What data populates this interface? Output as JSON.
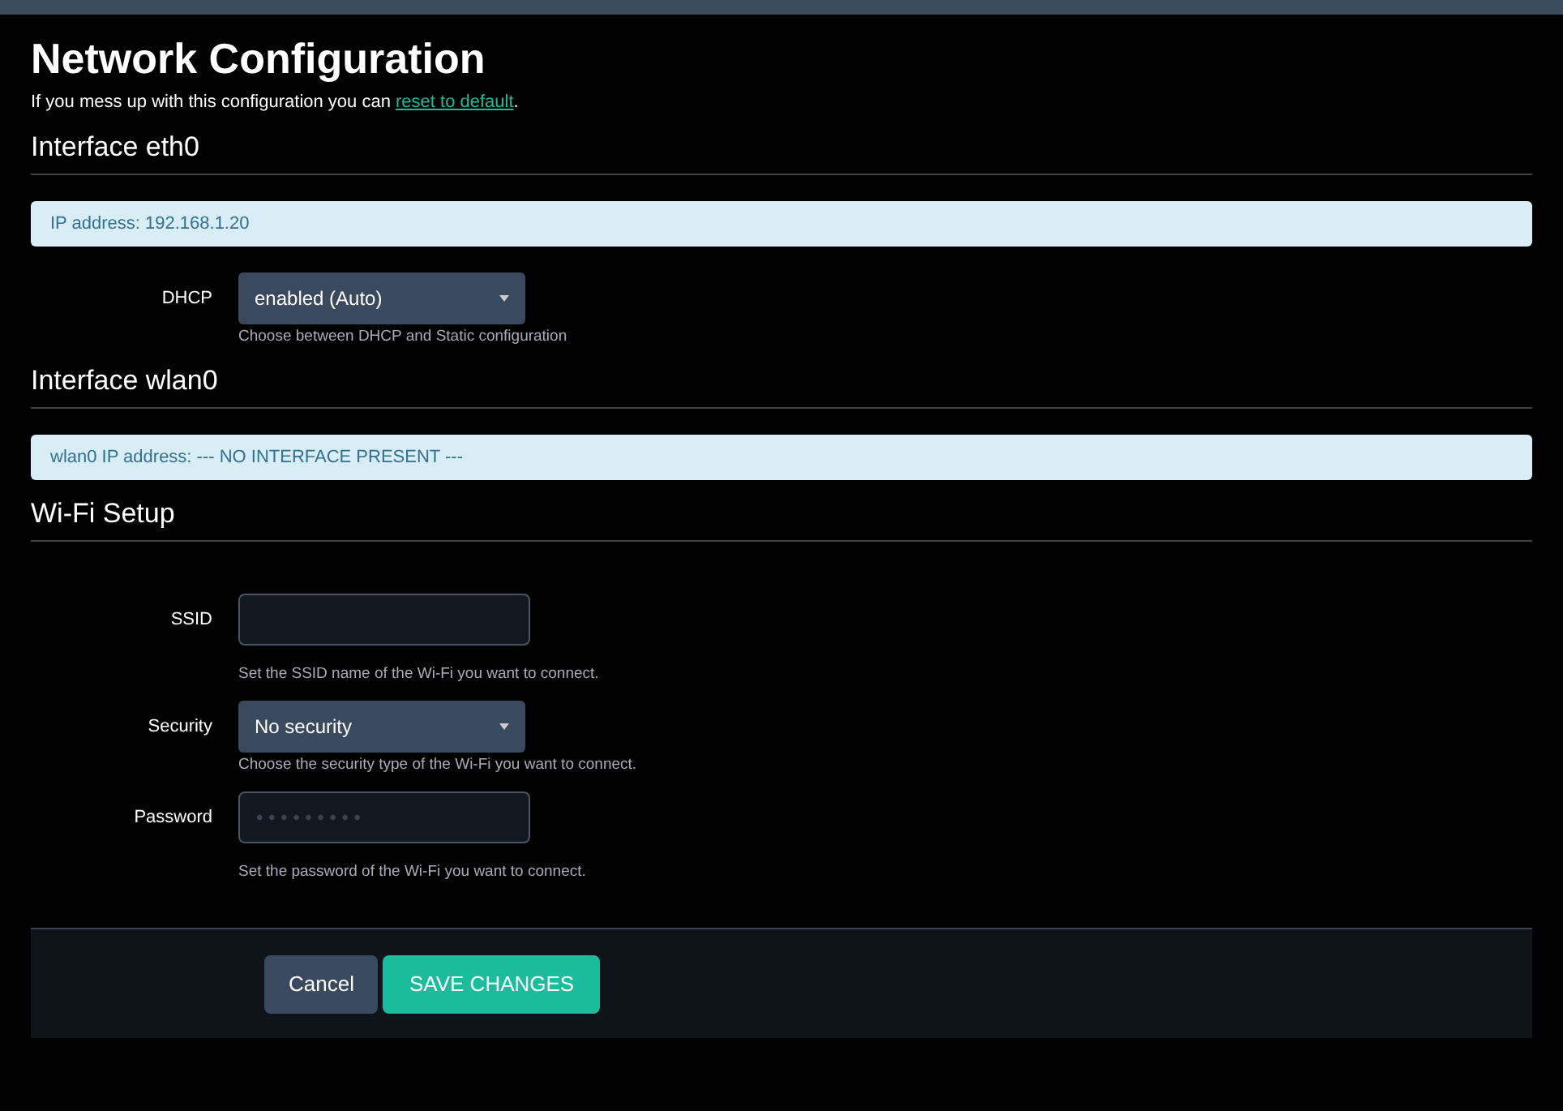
{
  "title": "Network Configuration",
  "intro": {
    "before": "If you mess up with this configuration you can ",
    "link": "reset to default",
    "after": "."
  },
  "sections": [
    {
      "heading": "Interface eth0",
      "alert": "IP address: 192.168.1.20",
      "fields": [
        {
          "kind": "select",
          "label": "DHCP",
          "value": "enabled (Auto)",
          "help": "Choose between DHCP and Static configuration"
        }
      ]
    },
    {
      "heading": "Interface wlan0",
      "alert": "wlan0 IP address: --- NO INTERFACE PRESENT ---"
    },
    {
      "heading": "Wi-Fi Setup",
      "fields": [
        {
          "kind": "text",
          "label": "SSID",
          "help": "Set the SSID name of the Wi-Fi you want to connect."
        },
        {
          "kind": "select",
          "label": "Security",
          "value": "No security",
          "help": "Choose the security type of the Wi-Fi you want to connect."
        },
        {
          "kind": "password",
          "label": "Password",
          "placeholder": "• • • • • • • • •",
          "help": "Set the password of the Wi-Fi you want to connect."
        }
      ]
    }
  ],
  "buttons": [
    {
      "kind": "secondary",
      "label": "Cancel"
    },
    {
      "kind": "primary",
      "label": "SAVE CHANGES"
    }
  ]
}
